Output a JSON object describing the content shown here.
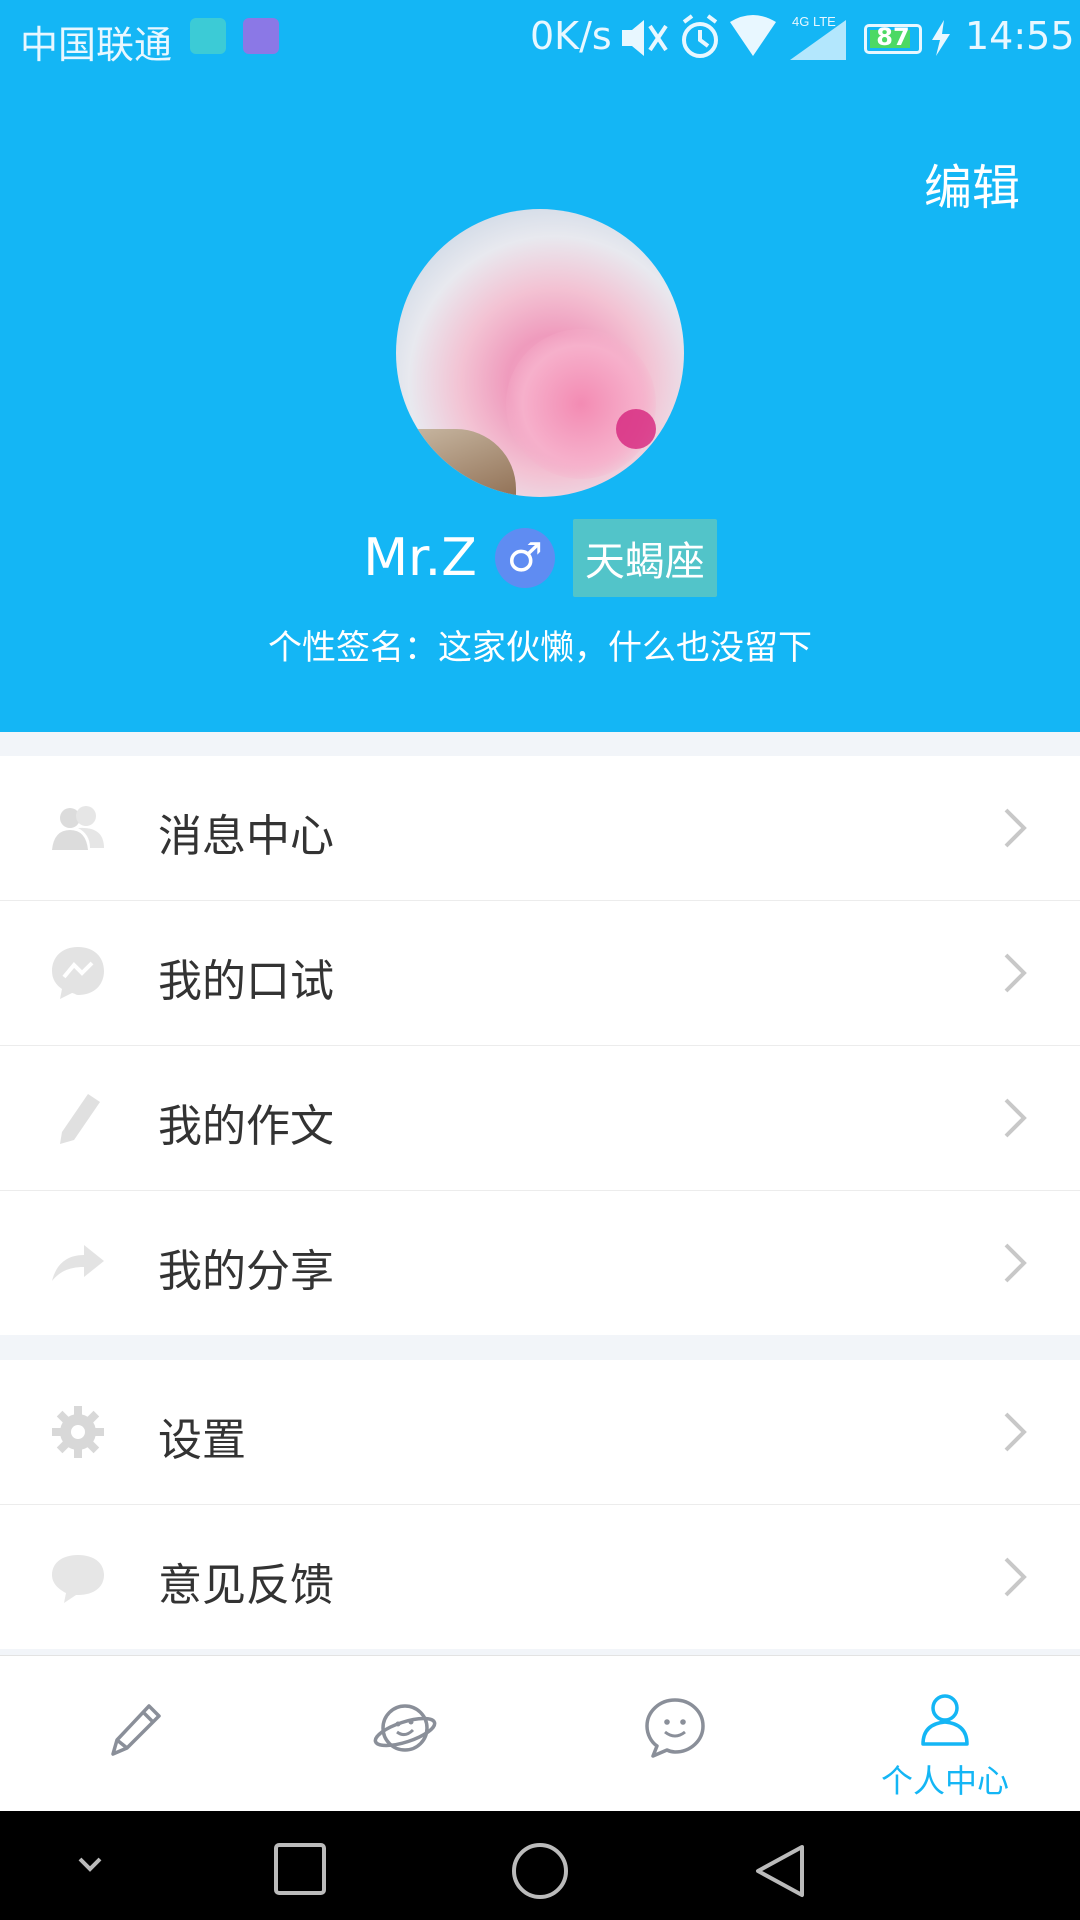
{
  "status_bar": {
    "carrier": "中国联通",
    "net_speed": "0K/s",
    "network_type": "4G LTE",
    "battery": "87",
    "time": "14:55",
    "icons": [
      "android-notification-icon",
      "screenshot-notification-icon",
      "mute-icon",
      "alarm-icon",
      "wifi-icon",
      "signal-icon",
      "battery-icon",
      "charging-icon"
    ]
  },
  "header": {
    "edit_label": "编辑",
    "username": "Mr.Z",
    "gender_symbol": "♂",
    "zodiac": "天蝎座",
    "signature": "个性签名：这家伙懒，什么也没留下",
    "background_color": "#14b6f5"
  },
  "menu": {
    "group1": [
      {
        "label": "消息中心",
        "icon": "people-icon"
      },
      {
        "label": "我的口试",
        "icon": "chat-bubble-icon"
      },
      {
        "label": "我的作文",
        "icon": "pencil-icon"
      },
      {
        "label": "我的分享",
        "icon": "share-arrow-icon"
      }
    ],
    "group2": [
      {
        "label": "设置",
        "icon": "gear-icon"
      },
      {
        "label": "意见反馈",
        "icon": "feedback-bubble-icon"
      }
    ]
  },
  "tabbar": {
    "tabs": [
      {
        "icon": "pencil-icon",
        "label": ""
      },
      {
        "icon": "planet-icon",
        "label": ""
      },
      {
        "icon": "smiley-chat-icon",
        "label": ""
      },
      {
        "icon": "person-icon",
        "label": "个人中心",
        "active": true
      }
    ],
    "active_color": "#14b6f5"
  },
  "nav_bar": {
    "icons": [
      "hide-keyboard-icon",
      "recents-icon",
      "home-icon",
      "back-icon"
    ]
  }
}
